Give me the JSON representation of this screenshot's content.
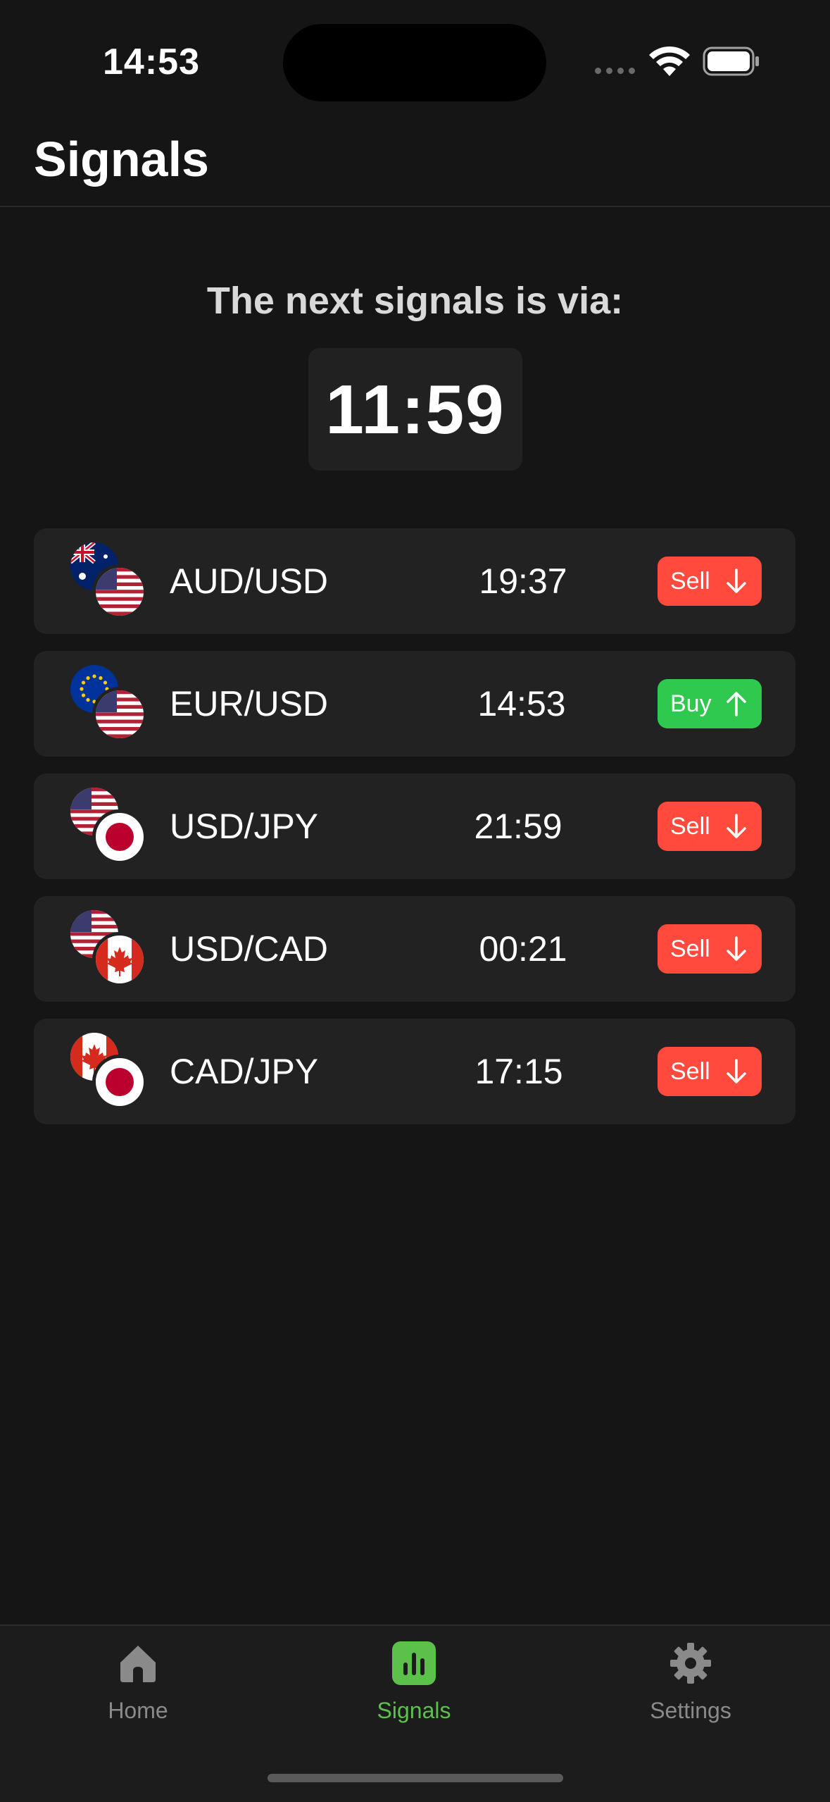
{
  "status_bar": {
    "time": "14:53"
  },
  "header": {
    "title": "Signals"
  },
  "countdown": {
    "label": "The next signals is via:",
    "value": "11:59"
  },
  "signals": [
    {
      "pair": "AUD/USD",
      "time": "19:37",
      "action": "Sell",
      "direction": "down",
      "flags": [
        "australia-flag",
        "usa-flag"
      ]
    },
    {
      "pair": "EUR/USD",
      "time": "14:53",
      "action": "Buy",
      "direction": "up",
      "flags": [
        "eu-flag",
        "usa-flag"
      ]
    },
    {
      "pair": "USD/JPY",
      "time": "21:59",
      "action": "Sell",
      "direction": "down",
      "flags": [
        "usa-flag",
        "japan-flag"
      ]
    },
    {
      "pair": "USD/CAD",
      "time": "00:21",
      "action": "Sell",
      "direction": "down",
      "flags": [
        "usa-flag",
        "canada-flag"
      ]
    },
    {
      "pair": "CAD/JPY",
      "time": "17:15",
      "action": "Sell",
      "direction": "down",
      "flags": [
        "canada-flag",
        "japan-flag"
      ]
    }
  ],
  "tabbar": {
    "tabs": [
      {
        "label": "Home",
        "icon": "home-icon",
        "active": false
      },
      {
        "label": "Signals",
        "icon": "chart-icon",
        "active": true
      },
      {
        "label": "Settings",
        "icon": "gear-icon",
        "active": false
      }
    ]
  },
  "colors": {
    "sell": "#ff4a3d",
    "buy": "#2fc94f",
    "accent": "#5cc14a",
    "background": "#151515",
    "card": "#222222"
  }
}
